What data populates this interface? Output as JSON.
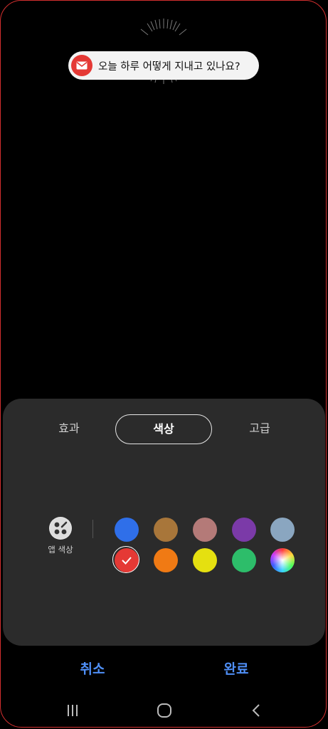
{
  "notification": {
    "text": "오늘 하루 어떻게 지내고 있나요?",
    "icon": "mail-icon"
  },
  "tabs": [
    {
      "label": "효과",
      "active": false
    },
    {
      "label": "색상",
      "active": true
    },
    {
      "label": "고급",
      "active": false
    }
  ],
  "app_color": {
    "label": "앱 색상",
    "icon": "palette-icon"
  },
  "colors": {
    "row1": [
      "#2f6fe9",
      "#a8763a",
      "#b47a78",
      "#7b3aa8",
      "#8aa6c0"
    ],
    "row2": [
      "#e53935",
      "#f07a14",
      "#e5e010",
      "#2dbd6a",
      "rainbow"
    ],
    "selected": "#e53935"
  },
  "actions": {
    "cancel": "취소",
    "done": "완료"
  },
  "navbar": {
    "recents": "recents-icon",
    "home": "home-icon",
    "back": "back-icon"
  },
  "accent": "#4f8ff7"
}
